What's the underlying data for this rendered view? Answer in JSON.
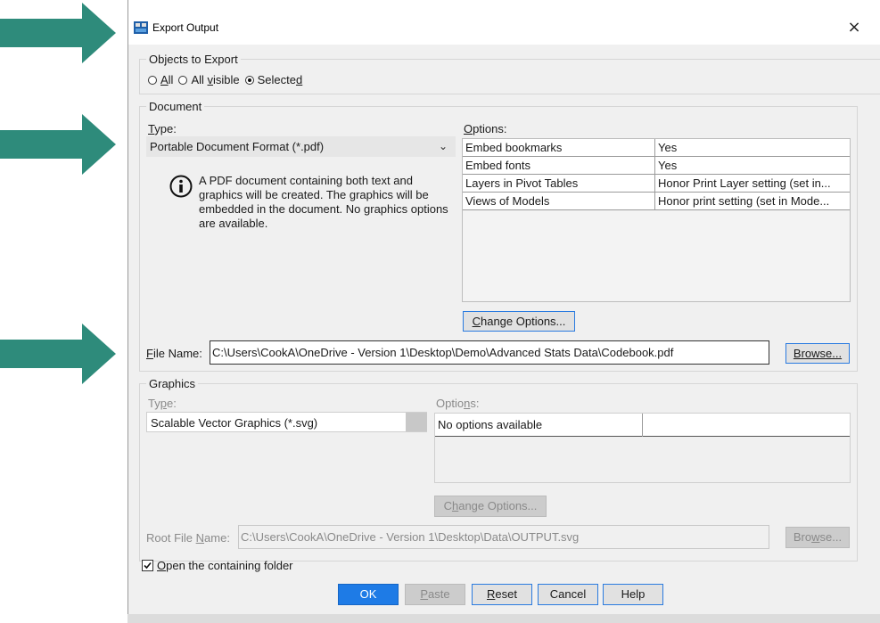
{
  "dialog": {
    "title": "Export Output",
    "close_glyph": "×"
  },
  "objects_to_export": {
    "label": "Objects to Export",
    "options": [
      {
        "label_pre": "",
        "label_u": "A",
        "label_post": "ll",
        "selected": false
      },
      {
        "label_pre": "All ",
        "label_u": "v",
        "label_post": "isible",
        "selected": false
      },
      {
        "label_pre": "Selecte",
        "label_u": "d",
        "label_post": "",
        "selected": true
      }
    ]
  },
  "document": {
    "label": "Document",
    "type_label_u": "T",
    "type_label_rest": "ype:",
    "type_value": "Portable Document Format (*.pdf)",
    "info_text": "A PDF document containing both text and graphics will be created. The graphics will be embedded in the document. No graphics options are available.",
    "options_label_u": "O",
    "options_label_rest": "ptions:",
    "options": [
      {
        "name": "Embed bookmarks",
        "value": "Yes"
      },
      {
        "name": "Embed fonts",
        "value": "Yes"
      },
      {
        "name": "Layers in Pivot Tables",
        "value": "Honor Print Layer setting (set in..."
      },
      {
        "name": "Views of Models",
        "value": "Honor print setting (set in Mode..."
      }
    ],
    "change_options_u": "C",
    "change_options_rest": "hange Options...",
    "file_name_label_u": "F",
    "file_name_label_rest": "ile Name:",
    "file_name_value": "C:\\Users\\CookA\\OneDrive - Version 1\\Desktop\\Demo\\Advanced Stats Data\\Codebook.pdf",
    "browse_label": "Browse..."
  },
  "graphics": {
    "label": "Graphics",
    "type_label_pre": "Ty",
    "type_label_u": "p",
    "type_label_rest": "e:",
    "type_value": "Scalable Vector Graphics (*.svg)",
    "options_label_pre": "Optio",
    "options_label_u": "n",
    "options_label_rest": "s:",
    "options_value": "No options available",
    "change_options_pre": "C",
    "change_options_u": "h",
    "change_options_rest": "ange Options...",
    "root_label_pre": "Root File ",
    "root_label_u": "N",
    "root_label_rest": "ame:",
    "root_value": "C:\\Users\\CookA\\OneDrive - Version 1\\Desktop\\Data\\OUTPUT.svg",
    "browse_pre": "Bro",
    "browse_u": "w",
    "browse_rest": "se..."
  },
  "open_folder": {
    "checked": true,
    "label_u": "O",
    "label_rest": "pen the containing folder"
  },
  "buttons": {
    "ok": "OK",
    "paste_u": "P",
    "paste_rest": "aste",
    "reset_u": "R",
    "reset_rest": "eset",
    "cancel": "Cancel",
    "help": "Help"
  },
  "colors": {
    "arrow": "#2e8b7b",
    "primary_button": "#1e7be6"
  }
}
